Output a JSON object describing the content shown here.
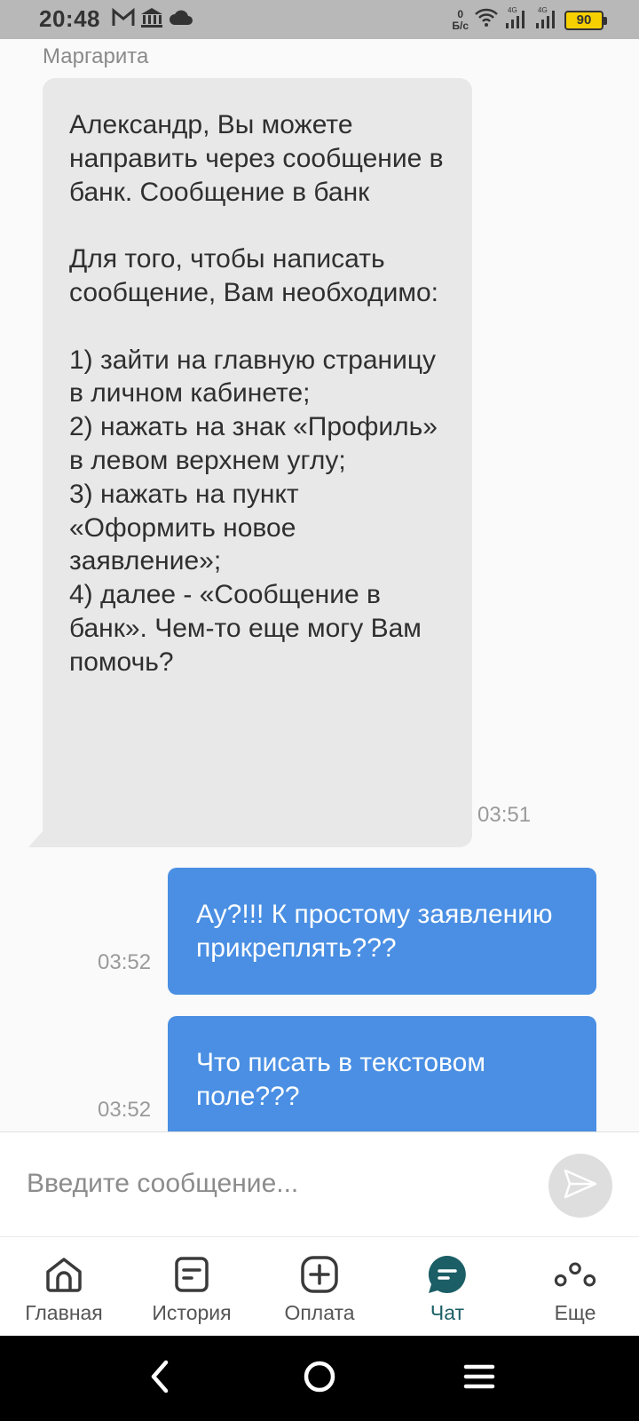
{
  "status_bar": {
    "time": "20:48",
    "net_speed_value": "0",
    "net_speed_unit": "Б/с",
    "battery_level": "90",
    "icons_left": [
      "mail-icon",
      "bank-icon",
      "cloud-icon"
    ],
    "icons_right": [
      "wifi-icon",
      "signal-4g-icon",
      "signal-4g-icon",
      "battery-icon"
    ]
  },
  "chat": {
    "sender_name": "Маргарита",
    "messages": [
      {
        "direction": "incoming",
        "text": "Александр, Вы можете направить через сообщение в банк. Сообщение в банк\n\nДля того, чтобы написать сообщение, Вам необходимо:\n\n1) зайти на главную страницу в личном кабинете;\n2) нажать на знак «Профиль» в левом верхнем углу;\n3) нажать на пункт «Оформить новое заявление»;\n4) далее - «Сообщение в банк». Чем-то еще могу Вам помочь?",
        "time": "03:51"
      },
      {
        "direction": "outgoing",
        "text": "Ау?!!! К простому заявлению прикреплять???",
        "time": "03:52"
      },
      {
        "direction": "outgoing",
        "text": "Что писать в текстовом поле???",
        "time": "03:52"
      }
    ]
  },
  "input": {
    "placeholder": "Введите сообщение...",
    "value": "",
    "send_icon": "send-icon"
  },
  "tabs": [
    {
      "label": "Главная",
      "icon": "home-icon",
      "active": false
    },
    {
      "label": "История",
      "icon": "history-icon",
      "active": false
    },
    {
      "label": "Оплата",
      "icon": "payment-plus-icon",
      "active": false
    },
    {
      "label": "Чат",
      "icon": "chat-icon",
      "active": true
    },
    {
      "label": "Еще",
      "icon": "more-icon",
      "active": false
    }
  ],
  "system_nav": [
    "back-icon",
    "home-circle-icon",
    "menu-icon"
  ],
  "colors": {
    "accent": "#1b5e66",
    "outgoing_bubble": "#4a8fe3",
    "incoming_bubble": "#e8e8e8",
    "battery": "#f6d000"
  }
}
